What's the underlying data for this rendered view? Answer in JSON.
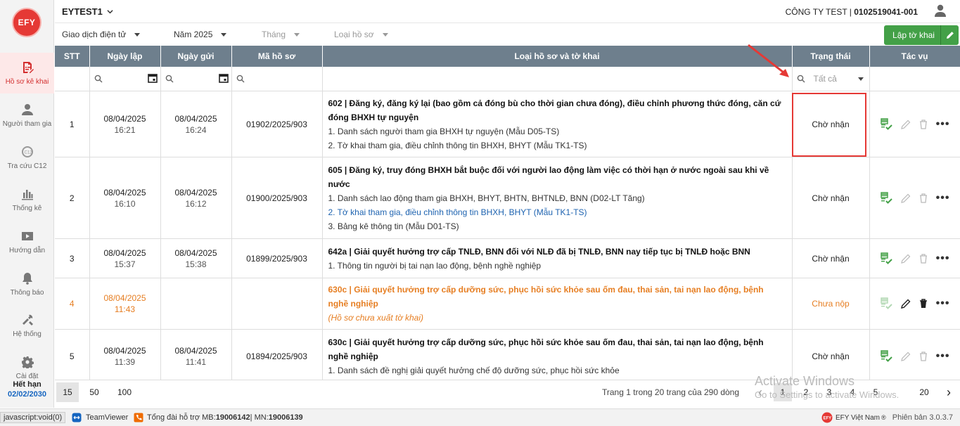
{
  "app": {
    "logo_text": "EFY",
    "tenant": "EYTEST1",
    "company_name": "CÔNG TY TEST | ",
    "company_tax": "0102519041-001"
  },
  "sidebar": {
    "items": [
      {
        "label": "Hồ sơ kê khai",
        "icon": "document-edit-icon",
        "active": true
      },
      {
        "label": "Người tham gia",
        "icon": "person-icon"
      },
      {
        "label": "Tra cứu C12",
        "icon": "c12-search-icon"
      },
      {
        "label": "Thống kê",
        "icon": "bar-chart-icon"
      },
      {
        "label": "Hướng dẫn",
        "icon": "guide-video-icon"
      },
      {
        "label": "Thông báo",
        "icon": "bell-icon"
      },
      {
        "label": "Hệ thống",
        "icon": "tools-icon"
      },
      {
        "label": "Cài đặt",
        "icon": "gear-icon"
      }
    ],
    "expiry_label": "Hết hạn",
    "expiry_date": "02/02/2030"
  },
  "filters": {
    "transaction": "Giao dịch điện tử",
    "year": "Năm 2025",
    "month": "Tháng",
    "form_type": "Loại hồ sơ"
  },
  "create_button": "Lập tờ khai",
  "table": {
    "headers": [
      "STT",
      "Ngày lập",
      "Ngày gửi",
      "Mã hồ sơ",
      "Loại hồ sơ và tờ khai",
      "Trạng thái",
      "Tác vụ"
    ],
    "status_filter_placeholder": "Tất cả",
    "rows": [
      {
        "stt": "1",
        "created_date": "08/04/2025",
        "created_time": "16:21",
        "sent_date": "08/04/2025",
        "sent_time": "16:24",
        "code": "01902/2025/903",
        "title": "602 | Đăng ký, đăng ký lại (bao gồm cả đóng bù cho thời gian chưa đóng), điều chỉnh phương thức đóng, căn cứ đóng BHXH tự nguyện",
        "subs": [
          "1. Danh sách người tham gia BHXH tự nguyện (Mẫu D05-TS)",
          "2. Tờ khai tham gia, điều chỉnh thông tin BHXH, BHYT (Mẫu TK1-TS)"
        ],
        "status": "Chờ nhận"
      },
      {
        "stt": "2",
        "created_date": "08/04/2025",
        "created_time": "16:10",
        "sent_date": "08/04/2025",
        "sent_time": "16:12",
        "code": "01900/2025/903",
        "title": "605 | Đăng ký, truy đóng BHXH bắt buộc đối với người lao động làm việc có thời hạn ở nước ngoài sau khi về nước",
        "subs": [
          "1. Danh sách lao động tham gia BHXH, BHYT, BHTN, BHTNLĐ, BNN (D02-LT Tăng)",
          "2. Tờ khai tham gia, điều chỉnh thông tin BHXH, BHYT (Mẫu TK1-TS)",
          "3. Bảng kê thông tin (Mẫu D01-TS)"
        ],
        "status": "Chờ nhận"
      },
      {
        "stt": "3",
        "created_date": "08/04/2025",
        "created_time": "15:37",
        "sent_date": "08/04/2025",
        "sent_time": "15:38",
        "code": "01899/2025/903",
        "title": "642a | Giải quyết hưởng trợ cấp TNLĐ, BNN đối với NLĐ đã bị TNLĐ, BNN nay tiếp tục bị TNLĐ hoặc BNN",
        "subs": [
          "1. Thông tin người bị tai nạn lao động, bệnh nghề nghiệp"
        ],
        "status": "Chờ nhận"
      },
      {
        "stt": "4",
        "created_date": "08/04/2025",
        "created_time": "11:43",
        "sent_date": "",
        "sent_time": "",
        "code": "",
        "title": "630c | Giải quyết hưởng trợ cấp dưỡng sức, phục hồi sức khỏe sau ốm đau, thai sản, tai nạn lao động, bệnh nghề nghiệp",
        "note": "(Hồ sơ chưa xuất tờ khai)",
        "status": "Chưa nộp"
      },
      {
        "stt": "5",
        "created_date": "08/04/2025",
        "created_time": "11:39",
        "sent_date": "08/04/2025",
        "sent_time": "11:41",
        "code": "01894/2025/903",
        "title": "630c | Giải quyết hưởng trợ cấp dưỡng sức, phục hồi sức khỏe sau ốm đau, thai sản, tai nạn lao động, bệnh nghề nghiệp",
        "subs": [
          "1. Danh sách đề nghị giải quyết hưởng chế độ dưỡng sức, phục hồi sức khỏe"
        ],
        "status": "Chờ nhận"
      }
    ]
  },
  "pagination": {
    "sizes": [
      "15",
      "50",
      "100"
    ],
    "info": "Trang 1 trong 20 trang của 290 dòng",
    "pages": [
      "1",
      "2",
      "3",
      "4",
      "5",
      "20"
    ],
    "prev": "‹",
    "next": "›"
  },
  "watermark": {
    "line1": "Activate Windows",
    "line2": "Go to Settings to activate Windows."
  },
  "statusbar": {
    "js": "javascript:void(0)",
    "teamviewer": "TeamViewer",
    "hotline_label": "Tổng đài hỗ trợ MB: ",
    "hotline_mb": "19006142",
    "hotline_sep": " | MN: ",
    "hotline_mn": "19006139",
    "brand": "EFY Việt Nam",
    "version": "Phiên bản 3.0.3.7"
  },
  "colors": {
    "primary_header": "#6e7f8d",
    "accent_red": "#e53935",
    "green": "#43a047",
    "orange": "#e67e22"
  }
}
